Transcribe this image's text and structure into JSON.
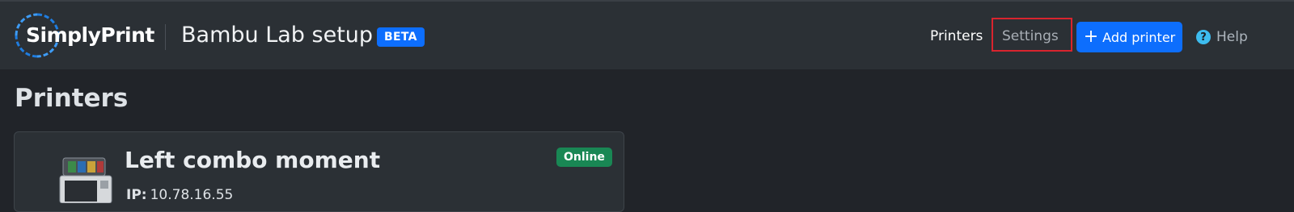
{
  "navbar": {
    "brand": "SimplyPrint",
    "page_heading": "Bambu Lab setup",
    "beta_badge": "BETA",
    "links": {
      "printers": "Printers",
      "settings": "Settings"
    },
    "add_printer_label": "Add printer",
    "help_label": "Help",
    "highlighted_item": "Settings",
    "colors": {
      "background": "#2b3035",
      "accent": "#0d6efd",
      "highlight": "#d9242e"
    }
  },
  "main": {
    "section_title": "Printers",
    "printer_card": {
      "name": "Left combo moment",
      "status": "Online",
      "status_color": "#198754",
      "ip_label": "IP:",
      "ip_value": "10.78.16.55"
    }
  }
}
